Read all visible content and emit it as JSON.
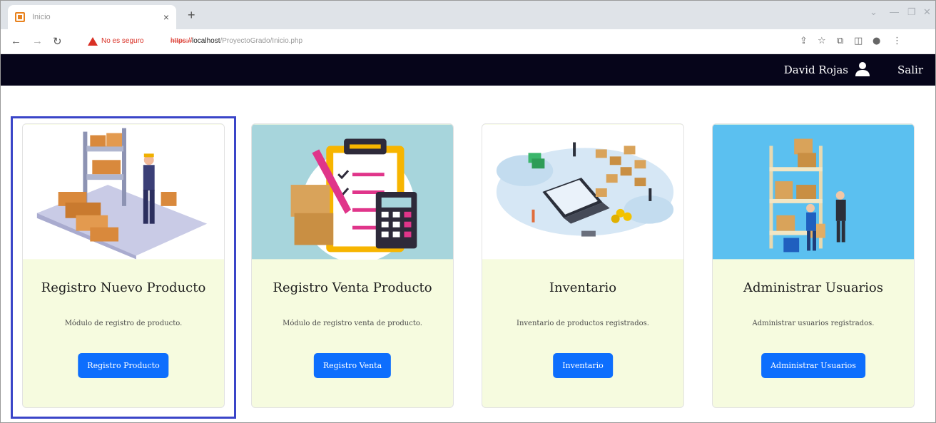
{
  "browser": {
    "tab_title": "Inicio",
    "tab_close": "×",
    "new_tab": "+",
    "security_warning": "No es seguro",
    "url_scheme": "https://",
    "url_host": "localhost",
    "url_path": "/ProyectoGrado/Inicio.php",
    "icons": [
      "back-icon",
      "forward-icon",
      "reload-icon",
      "warning-icon",
      "share-icon",
      "star-icon",
      "extensions-icon",
      "sidepanel-icon",
      "profile-icon",
      "menu-icon"
    ]
  },
  "header": {
    "user_name": "David Rojas",
    "user_icon": "user-icon",
    "logout_label": "Salir",
    "background": "#06051a"
  },
  "cards": [
    {
      "title": "Registro Nuevo Producto",
      "description": "Módulo de registro de producto.",
      "button": "Registro Producto",
      "image": "warehouse-worker-illustration"
    },
    {
      "title": "Registro Venta Producto",
      "description": "Módulo de registro venta de producto.",
      "button": "Registro Venta",
      "image": "clipboard-calculator-illustration"
    },
    {
      "title": "Inventario",
      "description": "Inventario de productos registrados.",
      "button": "Inventario",
      "image": "laptop-inventory-illustration"
    },
    {
      "title": "Administrar Usuarios",
      "description": "Administrar usuarios registrados.",
      "button": "Administrar Usuarios",
      "image": "warehouse-shelves-illustration"
    }
  ],
  "colors": {
    "accent": "#0d6efd",
    "card_body": "#f6fbdf",
    "focus_ring": "#3a45c8"
  }
}
